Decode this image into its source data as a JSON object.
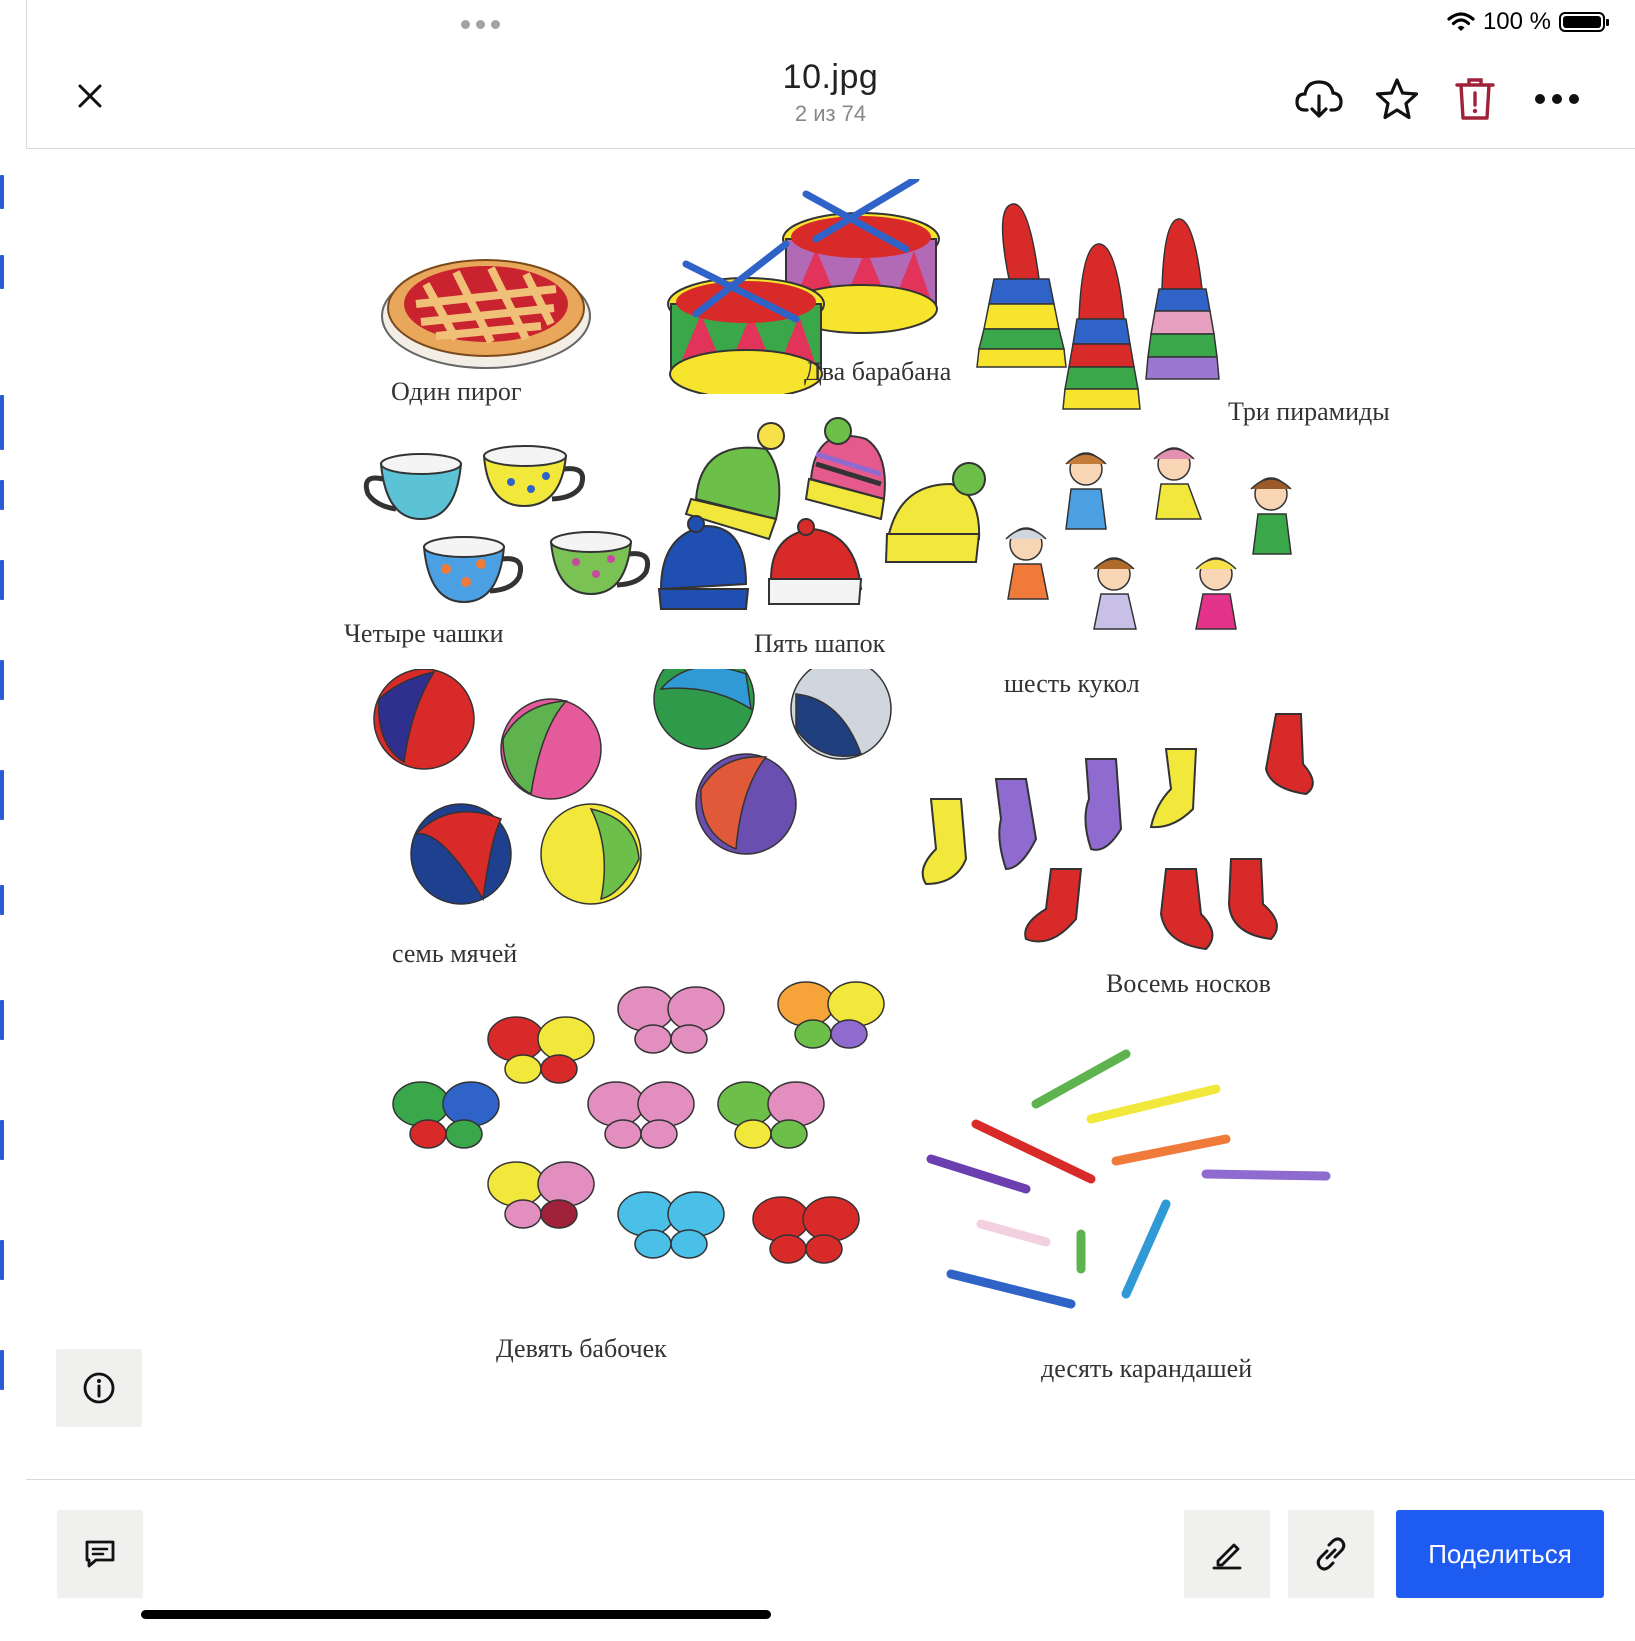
{
  "status": {
    "battery_text": "100 %"
  },
  "topbar": {
    "title": "10.jpg",
    "subtitle": "2 из 74",
    "icons": [
      "close-icon",
      "cloud-download-icon",
      "star-icon",
      "trash-icon",
      "more-icon"
    ]
  },
  "image": {
    "captions": {
      "pie": "Один пирог",
      "drums": "Два барабана",
      "pyramids": "Три пирамиды",
      "cups": "Четыре чашки",
      "hats": "Пять шапок",
      "dolls": "шесть кукол",
      "balls": "семь мячей",
      "socks": "Восемь носков",
      "butterflies": "Девять бабочек",
      "pencils": "десять карандашей"
    }
  },
  "bottombar": {
    "share_label": "Поделиться",
    "icons": [
      "comment-icon",
      "pencil-icon",
      "link-icon",
      "info-icon"
    ]
  },
  "colors": {
    "accent": "#1e5bf0",
    "trash": "#a0223a"
  }
}
